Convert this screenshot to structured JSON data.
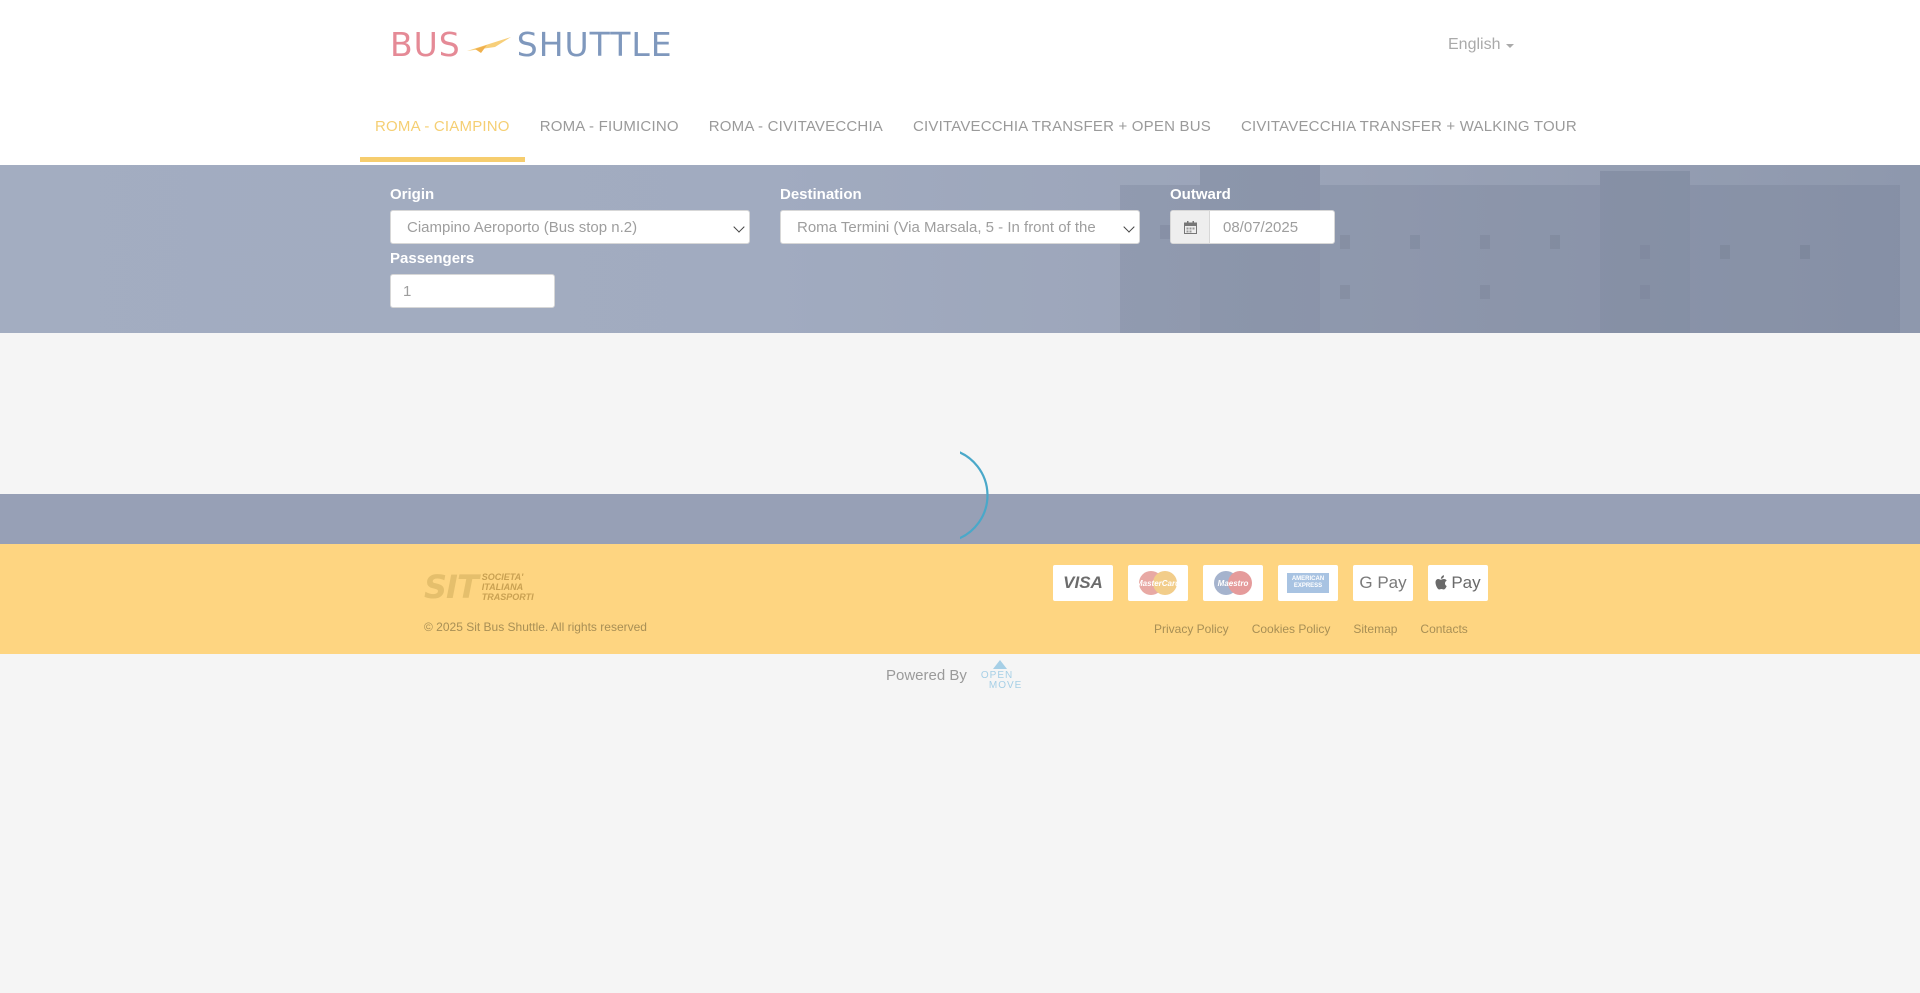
{
  "header": {
    "logo_left": "BUS",
    "logo_right": "SHUTTLE",
    "language": "English"
  },
  "nav": {
    "items": [
      {
        "label": "ROMA - CIAMPINO"
      },
      {
        "label": "ROMA - FIUMICINO"
      },
      {
        "label": "ROMA - CIVITAVECCHIA"
      },
      {
        "label": "CIVITAVECCHIA TRANSFER + OPEN BUS"
      },
      {
        "label": "CIVITAVECCHIA TRANSFER + WALKING TOUR"
      }
    ],
    "active_index": 0
  },
  "search": {
    "origin_label": "Origin",
    "origin_value": "Ciampino Aeroporto (Bus stop n.2)",
    "destination_label": "Destination",
    "destination_value": "Roma Termini (Via Marsala, 5 - In front of the",
    "outward_label": "Outward",
    "outward_value": "08/07/2025",
    "passengers_label": "Passengers",
    "passengers_value": "1"
  },
  "footer": {
    "sit_mark": "SIT",
    "sit_line1": "SOCIETA'",
    "sit_line2": "ITALIANA",
    "sit_line3": "TRASPORTI",
    "copyright": "© 2025 Sit Bus Shuttle. All rights reserved",
    "payments": [
      {
        "label": "VISA",
        "icon": "visa-icon"
      },
      {
        "label": "MasterCard",
        "icon": "mastercard-icon"
      },
      {
        "label": "Maestro",
        "icon": "maestro-icon"
      },
      {
        "label": "AMERICAN EXPRESS",
        "icon": "amex-icon"
      },
      {
        "label": "G Pay",
        "icon": "google-pay-icon"
      },
      {
        "label": "Pay",
        "icon": "apple-pay-icon"
      }
    ],
    "links": [
      {
        "label": "Privacy Policy"
      },
      {
        "label": "Cookies Policy"
      },
      {
        "label": "Sitemap"
      },
      {
        "label": "Contacts"
      }
    ]
  },
  "powered": {
    "label": "Powered By",
    "brand_line1": "OPEN",
    "brand_line2": "MOVE"
  },
  "colors": {
    "accent": "#f6cd6e",
    "footer_bg": "#fed581",
    "search_bg": "#a1abc0",
    "spinner": "#4aa8c9"
  }
}
